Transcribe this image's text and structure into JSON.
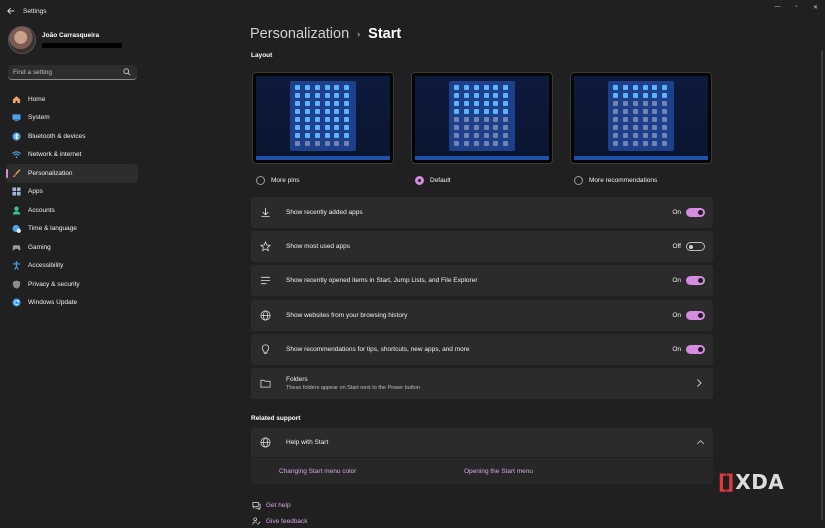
{
  "window": {
    "title": "Settings",
    "controls": {
      "minimize": "—",
      "maximize": "▫",
      "close": "✕"
    }
  },
  "profile": {
    "name": "João Carrasqueira"
  },
  "search": {
    "placeholder": "Find a setting"
  },
  "sidebar": {
    "items": [
      {
        "label": "Home",
        "icon": "home-icon",
        "color": "#f0a46a"
      },
      {
        "label": "System",
        "icon": "monitor-icon",
        "color": "#4aa3ea"
      },
      {
        "label": "Bluetooth & devices",
        "icon": "bluetooth-icon",
        "color": "#4aa3ea"
      },
      {
        "label": "Network & internet",
        "icon": "wifi-icon",
        "color": "#4aa3ea"
      },
      {
        "label": "Personalization",
        "icon": "paintbrush-icon",
        "color": "#e8a060",
        "active": true
      },
      {
        "label": "Apps",
        "icon": "apps-icon",
        "color": "#9fb4d6"
      },
      {
        "label": "Accounts",
        "icon": "person-icon",
        "color": "#3fc28d"
      },
      {
        "label": "Time & language",
        "icon": "globe-clock-icon",
        "color": "#4aa3ea"
      },
      {
        "label": "Gaming",
        "icon": "controller-icon",
        "color": "#9a9a9a"
      },
      {
        "label": "Accessibility",
        "icon": "accessibility-icon",
        "color": "#4aa3ea"
      },
      {
        "label": "Privacy & security",
        "icon": "shield-icon",
        "color": "#8c8c8c"
      },
      {
        "label": "Windows Update",
        "icon": "update-icon",
        "color": "#2f8fe3"
      }
    ]
  },
  "breadcrumb": {
    "parent": "Personalization",
    "separator": "›",
    "current": "Start"
  },
  "layout_section": {
    "title": "Layout",
    "options": [
      {
        "label": "More pins",
        "checked": false
      },
      {
        "label": "Default",
        "checked": true
      },
      {
        "label": "More recommendations",
        "checked": false
      }
    ]
  },
  "settings": [
    {
      "label": "Show recently added apps",
      "icon": "download-icon",
      "state": "On",
      "on": true
    },
    {
      "label": "Show most used apps",
      "icon": "star-icon",
      "state": "Off",
      "on": false
    },
    {
      "label": "Show recently opened items in Start, Jump Lists, and File Explorer",
      "icon": "list-icon",
      "state": "On",
      "on": true
    },
    {
      "label": "Show websites from your browsing history",
      "icon": "globe-icon",
      "state": "On",
      "on": true
    },
    {
      "label": "Show recommendations for tips, shortcuts, new apps, and more",
      "icon": "lightbulb-icon",
      "state": "On",
      "on": true
    }
  ],
  "folders": {
    "label": "Folders",
    "description": "These folders appear on Start next to the Power button"
  },
  "related_support": {
    "title": "Related support",
    "help_title": "Help with Start",
    "links": [
      "Changing Start menu color",
      "Opening the Start menu"
    ]
  },
  "footer": {
    "get_help": "Get help",
    "give_feedback": "Give feedback"
  },
  "watermark": {
    "bracket": "[]",
    "text": "XDA"
  },
  "colors": {
    "accent": "#d48be0",
    "background": "#202020",
    "card": "#2b2b2b"
  }
}
